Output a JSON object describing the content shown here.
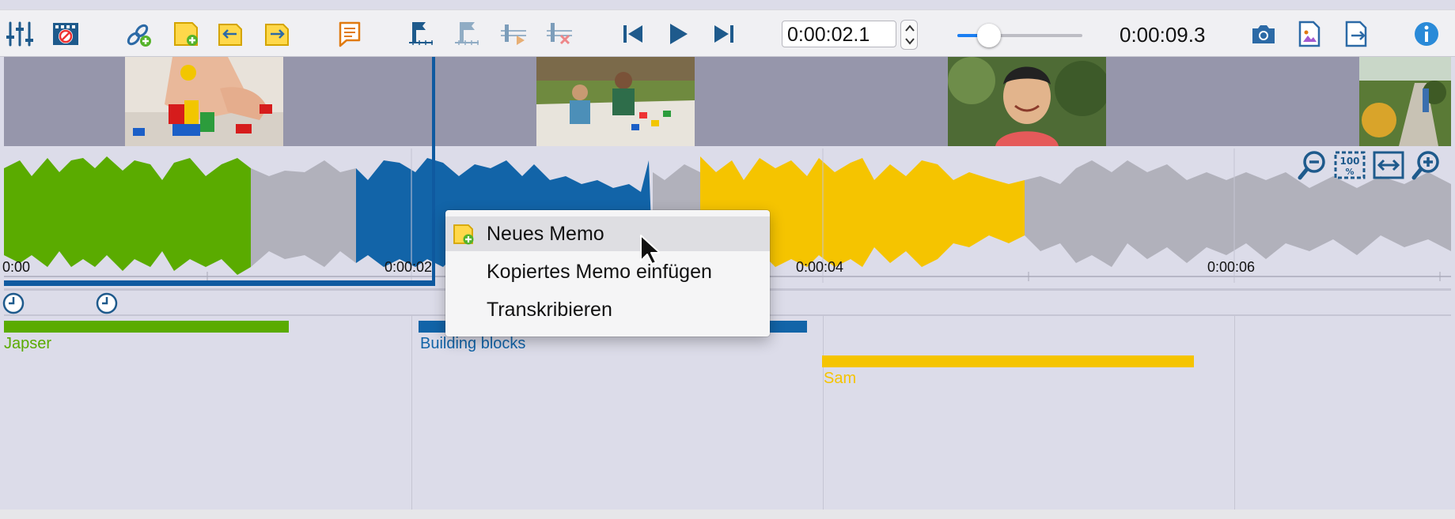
{
  "toolbar": {
    "buttons": [
      {
        "name": "settings-sliders-icon"
      },
      {
        "name": "video-overlay-icon"
      },
      {
        "name": "add-link-icon"
      },
      {
        "name": "new-memo-icon"
      },
      {
        "name": "memo-import-icon"
      },
      {
        "name": "memo-export-icon"
      },
      {
        "name": "comment-memo-icon"
      },
      {
        "name": "set-marker-icon"
      },
      {
        "name": "marker-off-icon"
      },
      {
        "name": "marker-play-icon"
      },
      {
        "name": "delete-marker-icon"
      },
      {
        "name": "skip-back-icon"
      },
      {
        "name": "play-icon"
      },
      {
        "name": "skip-forward-icon"
      },
      {
        "name": "camera-icon"
      },
      {
        "name": "image-doc-icon"
      },
      {
        "name": "export-doc-icon"
      },
      {
        "name": "info-icon"
      }
    ],
    "time_value": "0:00:02.1",
    "volume_level": 0.25,
    "duration": "0:00:09.3"
  },
  "timeline": {
    "ticks": [
      "0:00",
      "0:00:02",
      "0:00:04",
      "0:00:06"
    ],
    "playback_fraction": 0.22
  },
  "codes": [
    {
      "label": "Japser",
      "color": "#5aab00"
    },
    {
      "label": "Building blocks",
      "color": "#1264a8"
    },
    {
      "label": "Sam",
      "color": "#f5c400"
    }
  ],
  "context_menu": {
    "items": [
      "Neues Memo",
      "Kopiertes Memo einfügen",
      "Transkribieren"
    ],
    "highlighted_index": 0
  },
  "colors": {
    "accent": "#1a7ef2",
    "green": "#5aab00",
    "blue": "#1264a8",
    "yellow": "#f5c400",
    "grey_wave": "#b1b1bb"
  }
}
